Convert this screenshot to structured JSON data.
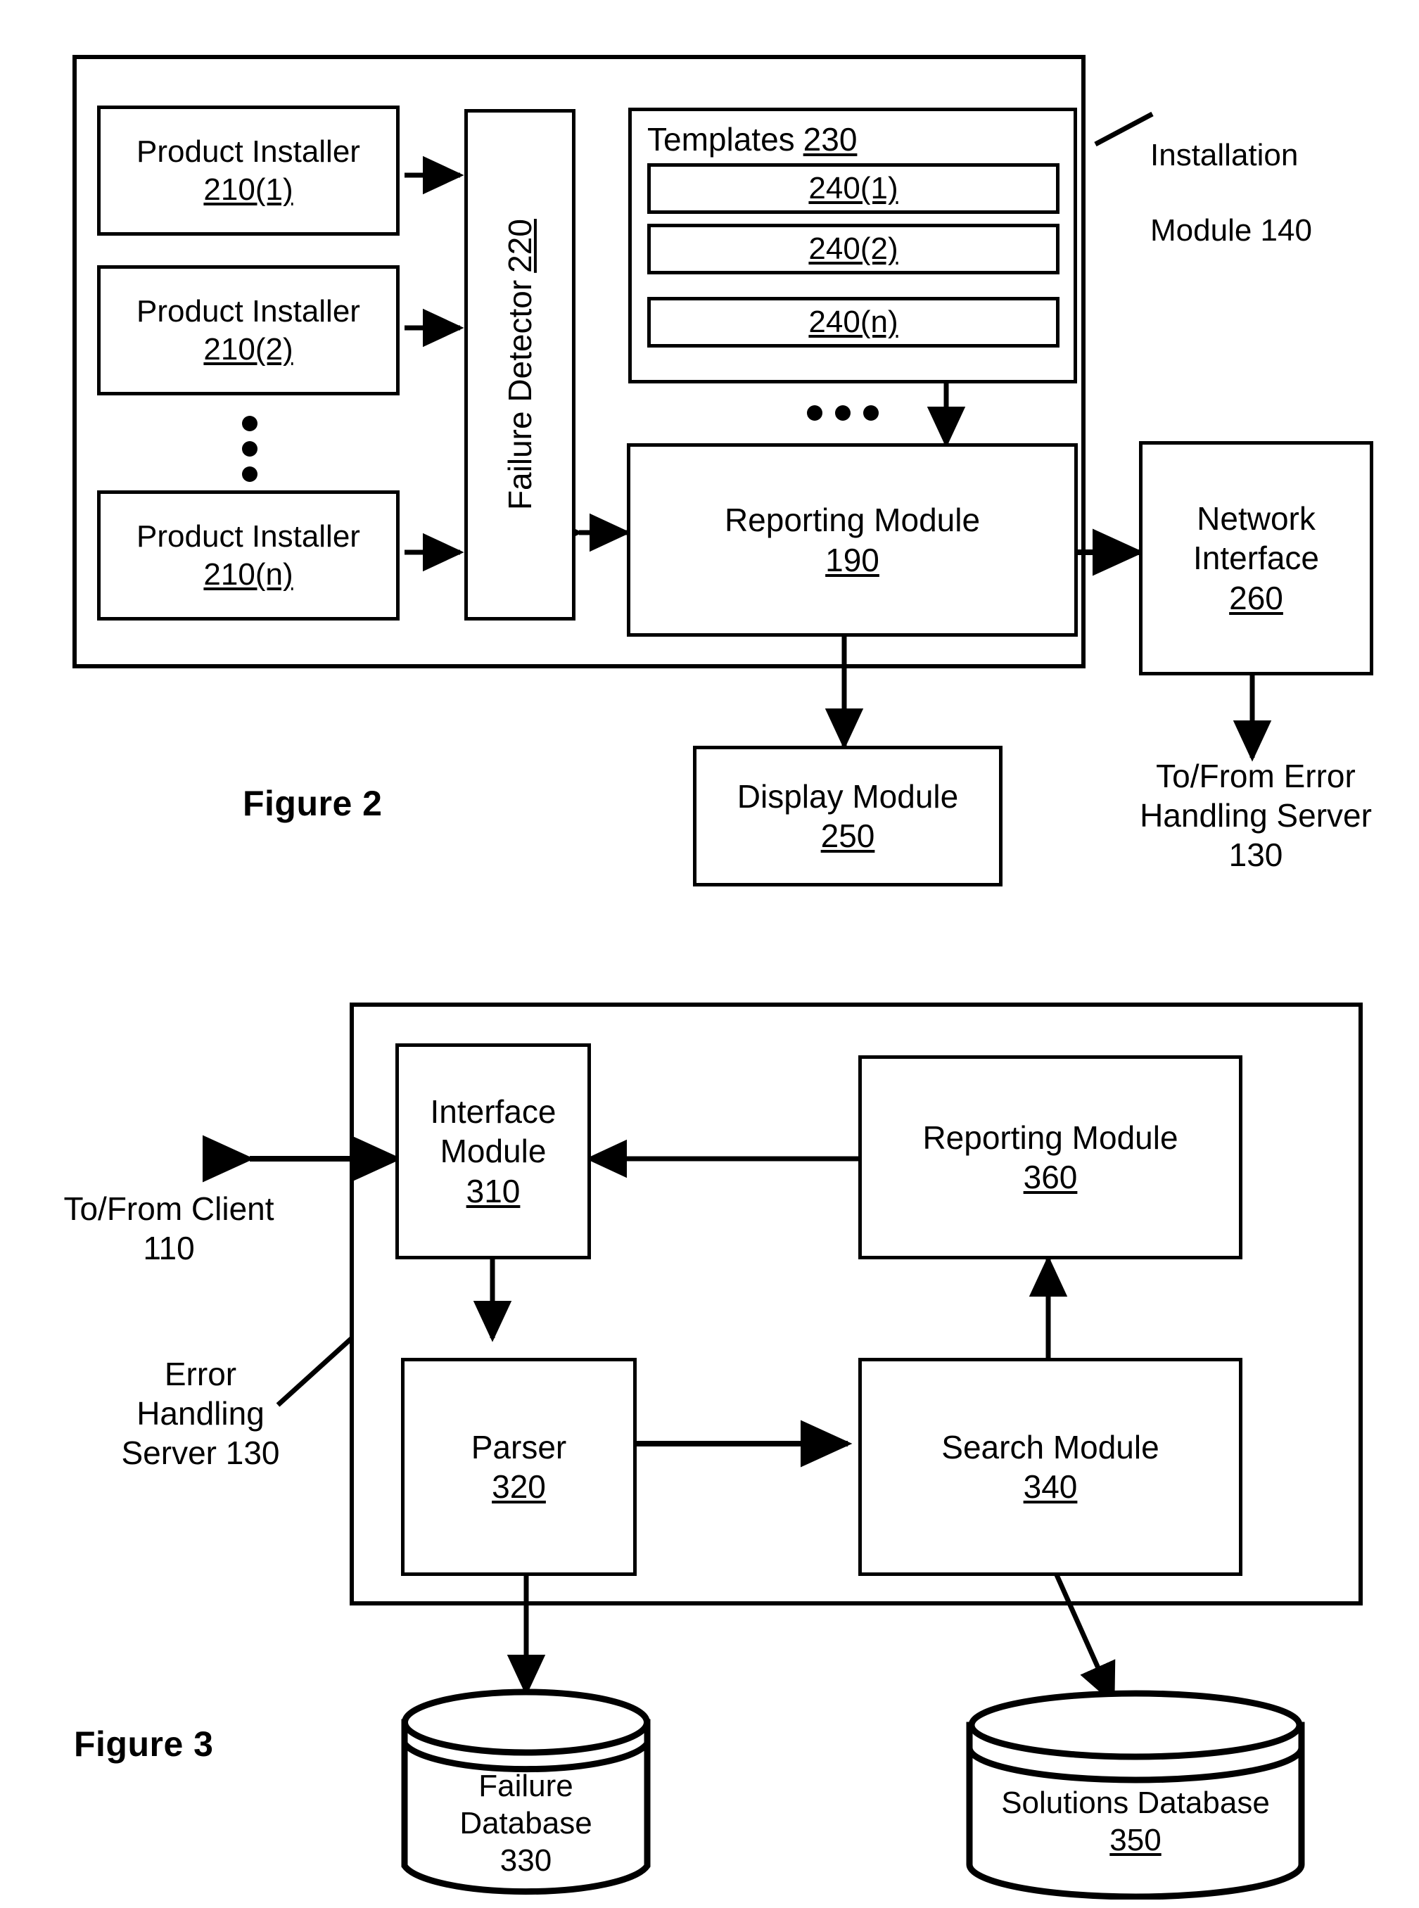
{
  "figure2": {
    "figure_label": "Figure 2",
    "outer_label_line1": "Installation",
    "outer_label_line2": "Module 140",
    "product_installers": [
      {
        "name": "Product Installer",
        "number": "210(1)"
      },
      {
        "name": "Product Installer",
        "number": "210(2)"
      },
      {
        "name": "Product Installer",
        "number": "210(n)"
      }
    ],
    "failure_detector": {
      "name": "Failure Detector",
      "number": "220"
    },
    "templates": {
      "title": "Templates",
      "number": "230",
      "items": [
        "240(1)",
        "240(2)",
        "240(n)"
      ]
    },
    "reporting_module": {
      "name": "Reporting Module",
      "number": "190"
    },
    "network_interface": {
      "name_line1": "Network",
      "name_line2": "Interface",
      "number": "260"
    },
    "display_module": {
      "name": "Display Module",
      "number": "250"
    },
    "to_from_error_handling_server": "To/From Error\nHandling Server\n130"
  },
  "figure3": {
    "figure_label": "Figure 3",
    "outer_label": "Error\nHandling\nServer 130",
    "to_from_client": "To/From Client\n110",
    "interface_module": {
      "name_line1": "Interface",
      "name_line2": "Module",
      "number": "310"
    },
    "reporting_module": {
      "name": "Reporting Module",
      "number": "360"
    },
    "parser": {
      "name": "Parser",
      "number": "320"
    },
    "search_module": {
      "name": "Search Module",
      "number": "340"
    },
    "failure_database": {
      "name_line1": "Failure",
      "name_line2": "Database",
      "number": "330"
    },
    "solutions_database": {
      "name": "Solutions Database",
      "number": "350"
    }
  },
  "colors": {
    "ink": "#000000",
    "paper": "#ffffff"
  }
}
